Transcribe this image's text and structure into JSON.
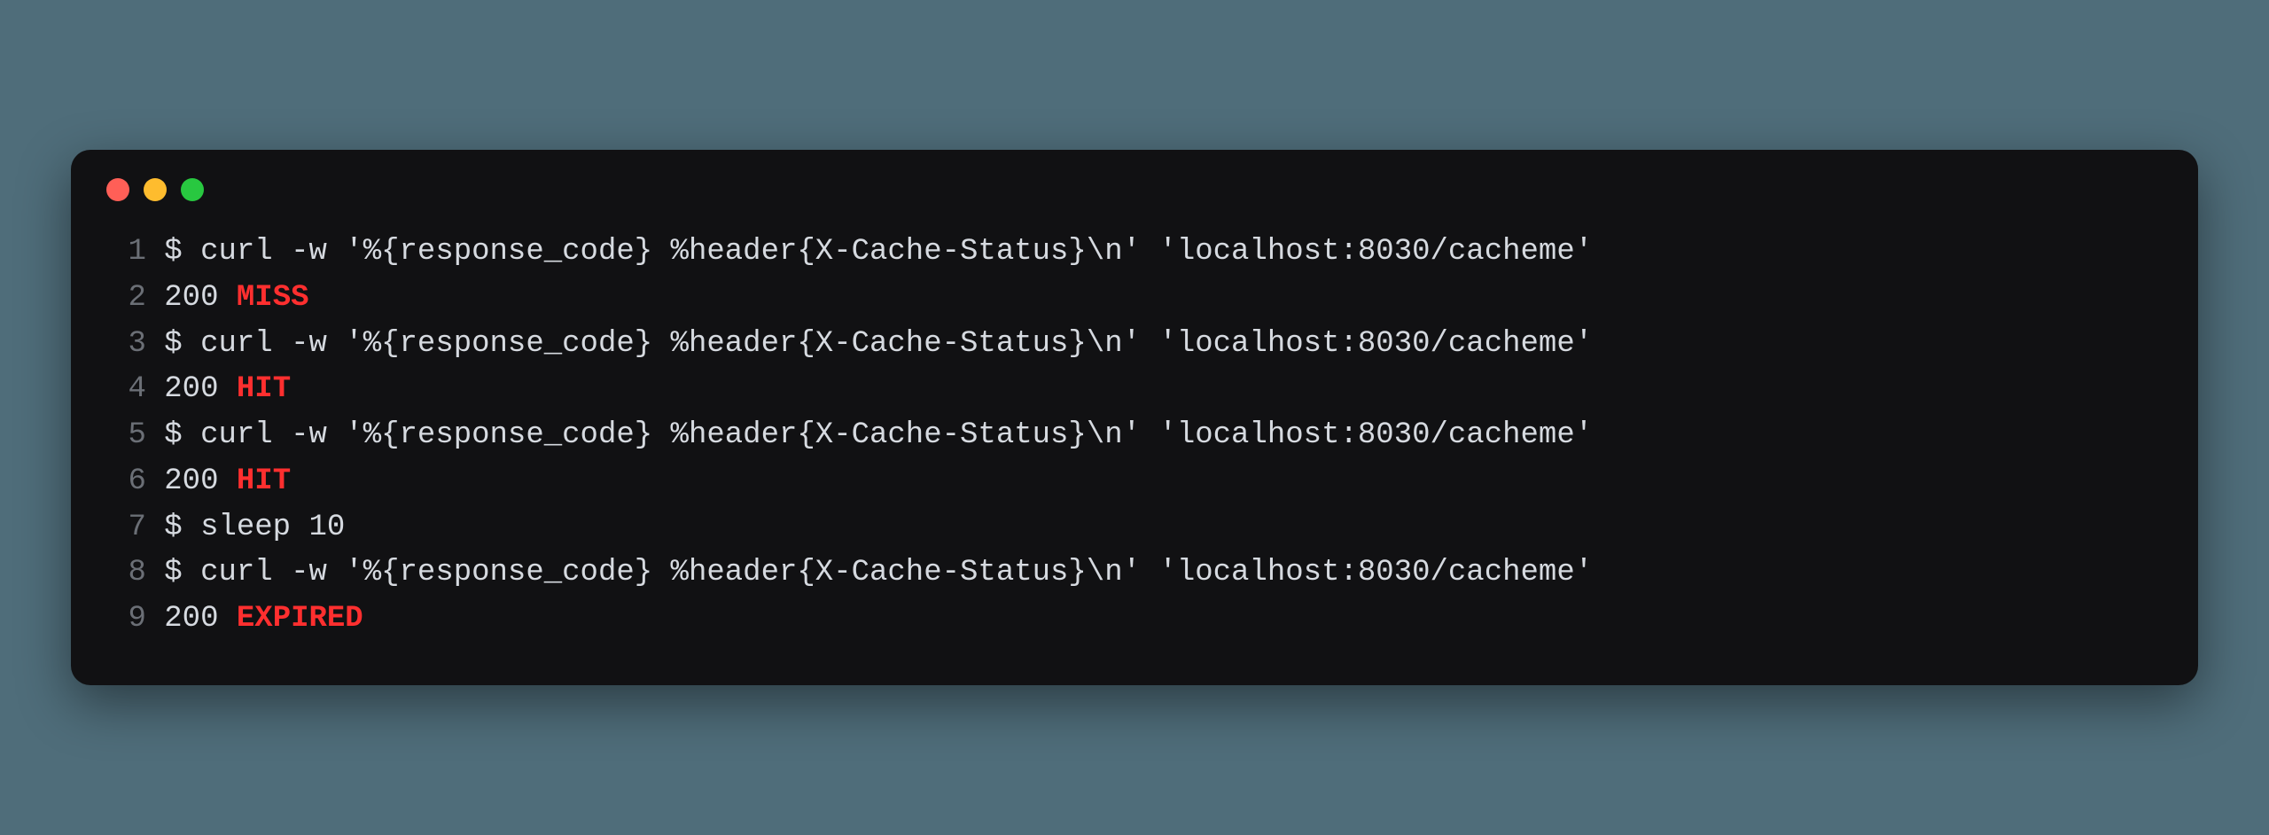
{
  "window": {
    "traffic_lights": [
      "close",
      "minimize",
      "zoom"
    ]
  },
  "code": {
    "lines": [
      {
        "n": "1",
        "segments": [
          {
            "kind": "plain",
            "text": "$ curl -w '%{response_code} %header{X-Cache-Status}\\n' 'localhost:8030/cacheme'"
          }
        ]
      },
      {
        "n": "2",
        "segments": [
          {
            "kind": "plain",
            "text": "200 "
          },
          {
            "kind": "status",
            "text": "MISS"
          }
        ]
      },
      {
        "n": "3",
        "segments": [
          {
            "kind": "plain",
            "text": "$ curl -w '%{response_code} %header{X-Cache-Status}\\n' 'localhost:8030/cacheme'"
          }
        ]
      },
      {
        "n": "4",
        "segments": [
          {
            "kind": "plain",
            "text": "200 "
          },
          {
            "kind": "status",
            "text": "HIT"
          }
        ]
      },
      {
        "n": "5",
        "segments": [
          {
            "kind": "plain",
            "text": "$ curl -w '%{response_code} %header{X-Cache-Status}\\n' 'localhost:8030/cacheme'"
          }
        ]
      },
      {
        "n": "6",
        "segments": [
          {
            "kind": "plain",
            "text": "200 "
          },
          {
            "kind": "status",
            "text": "HIT"
          }
        ]
      },
      {
        "n": "7",
        "segments": [
          {
            "kind": "plain",
            "text": "$ sleep 10"
          }
        ]
      },
      {
        "n": "8",
        "segments": [
          {
            "kind": "plain",
            "text": "$ curl -w '%{response_code} %header{X-Cache-Status}\\n' 'localhost:8030/cacheme'"
          }
        ]
      },
      {
        "n": "9",
        "segments": [
          {
            "kind": "plain",
            "text": "200 "
          },
          {
            "kind": "status",
            "text": "EXPIRED"
          }
        ]
      }
    ]
  },
  "colors": {
    "bg_page": "#4f6d7a",
    "bg_terminal": "#111113",
    "text": "#d6dae0",
    "gutter": "#6b6f76",
    "status": "#ff2f2f",
    "traffic_red": "#ff5f57",
    "traffic_yellow": "#febc2e",
    "traffic_green": "#28c840"
  }
}
